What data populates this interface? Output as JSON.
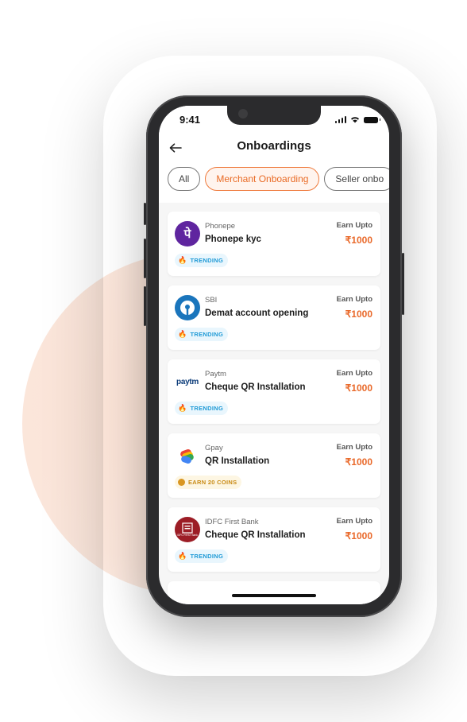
{
  "status": {
    "time": "9:41"
  },
  "header": {
    "title": "Onboardings",
    "back_icon": "arrow-left-icon"
  },
  "filters": [
    {
      "label": "All",
      "active": false
    },
    {
      "label": "Merchant Onboarding",
      "active": true
    },
    {
      "label": "Seller onbo",
      "active": false
    }
  ],
  "cards": [
    {
      "brand": "Phonepe",
      "title": "Phonepe kyc",
      "earn_label": "Earn Upto",
      "amount": "₹1000",
      "badge": "TRENDING",
      "badge_type": "trending",
      "logo_text": "पे",
      "logo_color": "#5f259f"
    },
    {
      "brand": "SBI",
      "title": "Demat account opening",
      "earn_label": "Earn Upto",
      "amount": "₹1000",
      "badge": "TRENDING",
      "badge_type": "trending",
      "logo_color": "#1a75bc"
    },
    {
      "brand": "Paytm",
      "title": "Cheque QR Installation",
      "earn_label": "Earn Upto",
      "amount": "₹1000",
      "badge": "TRENDING",
      "badge_type": "trending",
      "logo_text": "paytm",
      "logo_color": "#00baf2"
    },
    {
      "brand": "Gpay",
      "title": "QR Installation",
      "earn_label": "Earn Upto",
      "amount": "₹1000",
      "badge": "EARN 20 COINS",
      "badge_type": "coins"
    },
    {
      "brand": "IDFC First Bank",
      "title": "Cheque QR Installation",
      "earn_label": "Earn Upto",
      "amount": "₹1000",
      "badge": "TRENDING",
      "badge_type": "trending",
      "logo_text": "IDFC FIRST Bank",
      "logo_color": "#9c1d26"
    }
  ],
  "colors": {
    "accent": "#e9692a",
    "trending": "#1f9ad6",
    "coins": "#c98b16"
  }
}
